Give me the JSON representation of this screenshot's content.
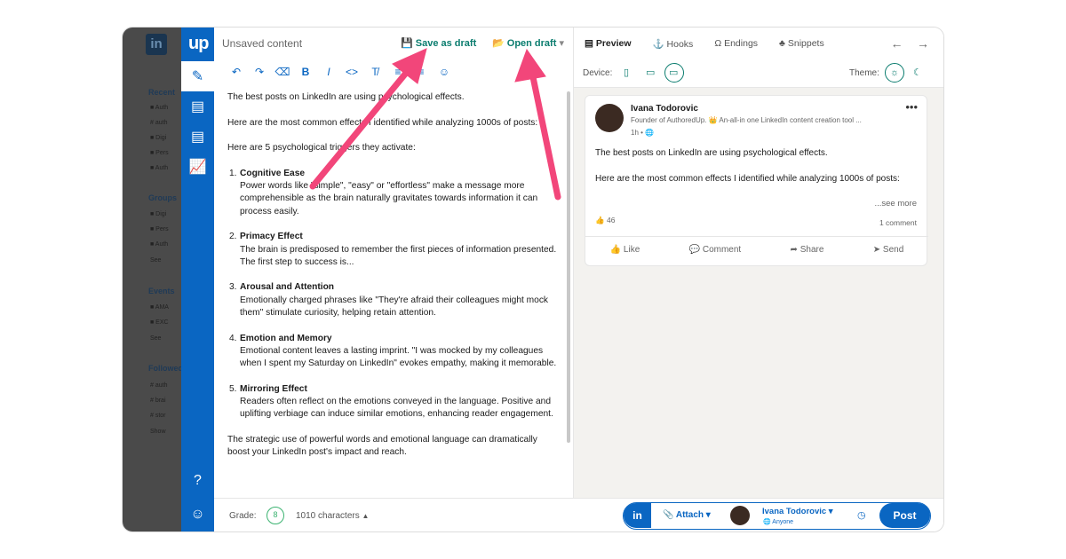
{
  "editor": {
    "title": "Unsaved content",
    "save_label": "Save as draft",
    "open_label": "Open draft",
    "paragraphs": [
      "The best posts on LinkedIn are using psychological effects.",
      "Here are the most common effects I identified while analyzing 1000s of posts:",
      "Here are 5 psychological triggers they activate:"
    ],
    "items": [
      {
        "num": "1.",
        "title": "Cognitive Ease",
        "text": "Power words like \"simple\", \"easy\" or \"effortless\" make a message more comprehensible as the brain naturally gravitates towards information it can process easily."
      },
      {
        "num": "2.",
        "title": "Primacy Effect",
        "text": "The brain is predisposed to remember the first pieces of information presented. The first step to success is..."
      },
      {
        "num": "3.",
        "title": "Arousal and Attention",
        "text": "Emotionally charged phrases like \"They're afraid their colleagues might mock them\" stimulate curiosity, helping retain attention."
      },
      {
        "num": "4.",
        "title": "Emotion and Memory",
        "text": "Emotional content leaves a lasting imprint. \"I was mocked by my colleagues when I spent my Saturday on LinkedIn\" evokes empathy, making it memorable."
      },
      {
        "num": "5.",
        "title": "Mirroring Effect",
        "text": "Readers often reflect on the emotions conveyed in the language. Positive and uplifting verbiage can induce similar emotions, enhancing reader engagement."
      }
    ],
    "closing": "The strategic use of powerful words and emotional language can dramatically boost your LinkedIn post's impact and reach."
  },
  "preview": {
    "tabs": [
      "Preview",
      "Hooks",
      "Endings",
      "Snippets"
    ],
    "device_label": "Device:",
    "theme_label": "Theme:",
    "post": {
      "author": "Ivana Todorovic",
      "role": "Founder of AuthoredUp. 👑 An-all-in one LinkedIn content creation tool ...",
      "time": "1h •",
      "line1": "The best posts on LinkedIn are using psychological effects.",
      "line2": "Here are the most common effects I identified while analyzing 1000s of posts:",
      "see_more": "...see more",
      "likes": "46",
      "comments": "1 comment",
      "actions": [
        "Like",
        "Comment",
        "Share",
        "Send"
      ]
    }
  },
  "bottom": {
    "grade_label": "Grade:",
    "grade_value": "8",
    "chars": "1010 characters",
    "attach": "Attach",
    "author": "Ivana Todorovic",
    "visibility": "Anyone",
    "post_button": "Post"
  },
  "background": {
    "sections": [
      "Recent",
      "Groups",
      "Events",
      "Followed"
    ]
  },
  "colors": {
    "brand_blue": "#0a66c2",
    "accent_teal": "#0a7c6e",
    "arrow_pink": "#f2467a"
  }
}
